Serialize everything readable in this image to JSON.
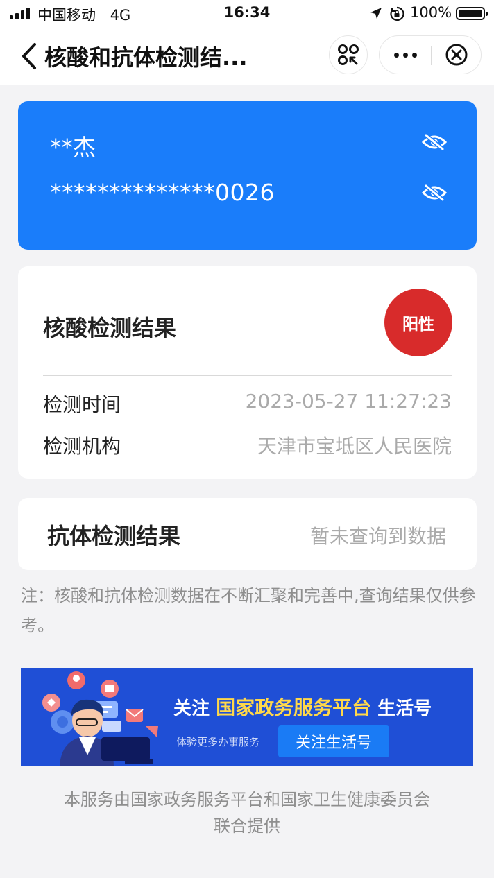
{
  "status_bar": {
    "carrier": "中国移动",
    "network": "4G",
    "time": "16:34",
    "battery": "100%",
    "icons": [
      "signal-icon",
      "location-arrow-icon",
      "orientation-lock-icon",
      "battery-icon"
    ]
  },
  "nav": {
    "title": "核酸和抗体检测结...",
    "icons": [
      "back-chevron-icon",
      "qr-scan-icon",
      "more-dots-icon",
      "close-circle-icon"
    ]
  },
  "identity": {
    "name": "**杰",
    "id_number": "**************0026",
    "icons": [
      "eye-hidden-icon"
    ]
  },
  "nucleic_result": {
    "title": "核酸检测结果",
    "status": "阳性",
    "test_time_label": "检测时间",
    "test_time": "2023-05-27 11:27:23",
    "institution_label": "检测机构",
    "institution": "天津市宝坻区人民医院"
  },
  "antibody_result": {
    "title": "抗体检测结果",
    "value": "暂未查询到数据"
  },
  "note": "注：核酸和抗体检测数据在不断汇聚和完善中,查询结果仅供参考。",
  "banner": {
    "prefix": "关注",
    "highlight": "国家政务服务平台",
    "suffix": "生活号",
    "subtitle": "体验更多办事服务",
    "button": "关注生活号"
  },
  "footer": {
    "line1": "本服务由国家政务服务平台和国家卫生健康委员会",
    "line2": "联合提供"
  },
  "colors": {
    "id_card_bg": "#1a7dfa",
    "positive_badge": "#d82b2b",
    "banner_bg": "#1f4fd6",
    "banner_highlight": "#ffd84a"
  }
}
